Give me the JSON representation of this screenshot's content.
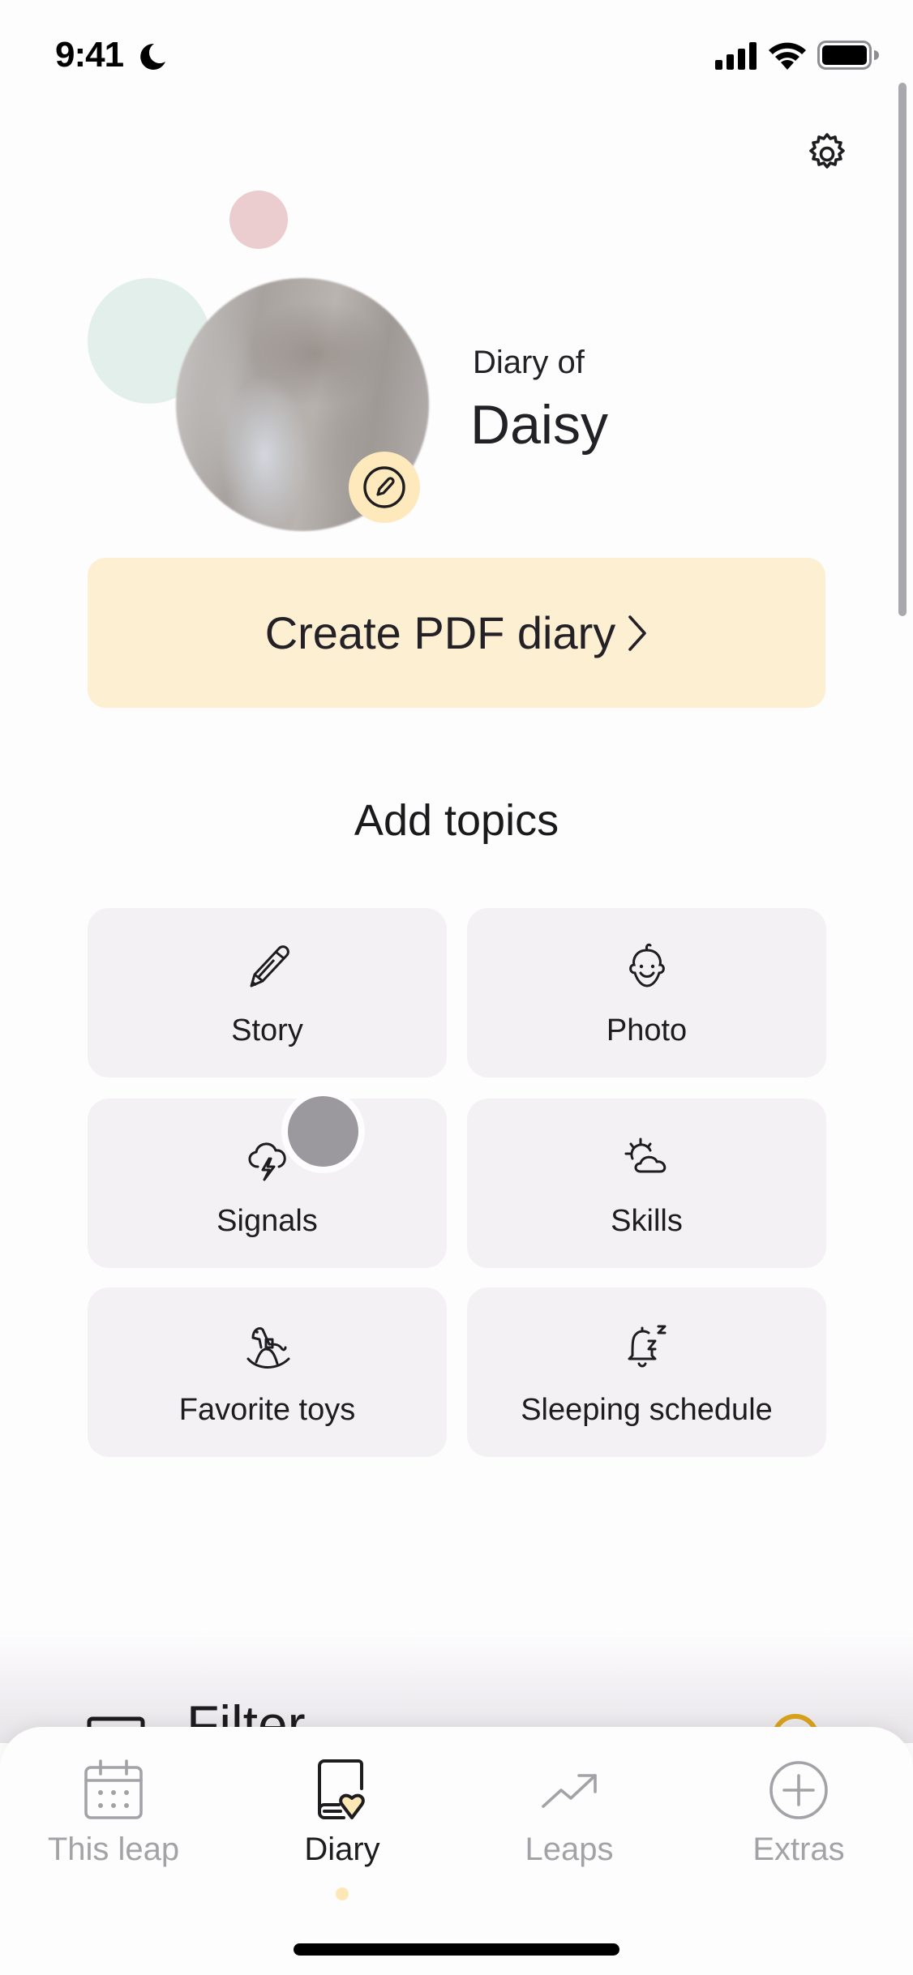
{
  "status_bar": {
    "time": "9:41",
    "focus_icon": "moon-icon",
    "signal_icon": "cellular-signal-icon",
    "wifi_icon": "wifi-icon",
    "battery_icon": "battery-icon"
  },
  "header": {
    "settings_icon": "gear-icon"
  },
  "profile": {
    "subtitle": "Diary of",
    "name": "Daisy",
    "edit_icon": "pencil-circle-icon"
  },
  "pdf_button": {
    "label": "Create PDF diary",
    "icon": "chevron-right-icon"
  },
  "topics": {
    "title": "Add topics",
    "items": [
      {
        "label": "Story",
        "icon": "pencil-icon"
      },
      {
        "label": "Photo",
        "icon": "baby-face-icon"
      },
      {
        "label": "Signals",
        "icon": "storm-cloud-icon"
      },
      {
        "label": "Skills",
        "icon": "sun-cloud-icon"
      },
      {
        "label": "Favorite toys",
        "icon": "rocking-horse-icon"
      },
      {
        "label": "Sleeping schedule",
        "icon": "sleep-bell-icon"
      }
    ]
  },
  "filter": {
    "label": "Filter"
  },
  "tab_bar": {
    "tabs": [
      {
        "label": "This leap",
        "icon": "calendar-icon",
        "active": false
      },
      {
        "label": "Diary",
        "icon": "diary-heart-icon",
        "active": true
      },
      {
        "label": "Leaps",
        "icon": "trend-up-icon",
        "active": false
      },
      {
        "label": "Extras",
        "icon": "plus-circle-icon",
        "active": false
      }
    ]
  },
  "colors": {
    "accent_yellow": "#fdefd2",
    "badge_yellow": "#fde9bb",
    "tile_bg": "#f3f1f4",
    "inactive_tab": "#a3a2a6",
    "filter_ring": "#d9a21b",
    "deco_pink": "#ebcccf",
    "deco_green": "#e3efea"
  }
}
